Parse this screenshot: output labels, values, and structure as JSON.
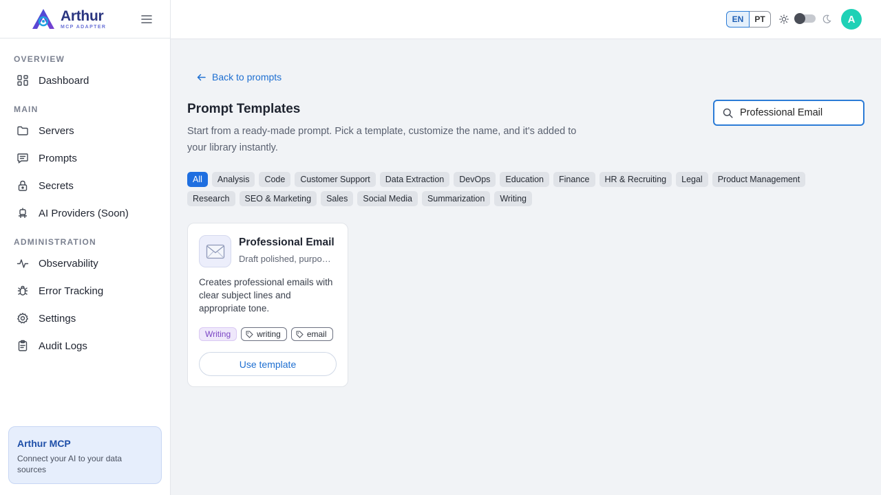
{
  "brand": {
    "name": "Arthur",
    "subtitle": "MCP ADAPTER"
  },
  "sidebar": {
    "sections": [
      {
        "label": "OVERVIEW"
      },
      {
        "label": "MAIN"
      },
      {
        "label": "ADMINISTRATION"
      }
    ],
    "items": [
      {
        "label": "Dashboard",
        "icon": "dashboard-icon"
      },
      {
        "label": "Servers",
        "icon": "folder-icon"
      },
      {
        "label": "Prompts",
        "icon": "message-icon"
      },
      {
        "label": "Secrets",
        "icon": "lock-icon"
      },
      {
        "label": "AI Providers (Soon)",
        "icon": "robot-icon"
      },
      {
        "label": "Observability",
        "icon": "activity-icon"
      },
      {
        "label": "Error Tracking",
        "icon": "bug-icon"
      },
      {
        "label": "Settings",
        "icon": "gear-icon"
      },
      {
        "label": "Audit Logs",
        "icon": "clipboard-icon"
      }
    ],
    "promo": {
      "title": "Arthur MCP",
      "description": "Connect your AI to your data sources"
    }
  },
  "topbar": {
    "languages": [
      "EN",
      "PT"
    ],
    "selected_language": "EN",
    "avatar_initial": "A"
  },
  "main": {
    "back_label": "Back to prompts",
    "title": "Prompt Templates",
    "description": "Start from a ready-made prompt. Pick a template, customize the name, and it's added to your library instantly.",
    "search": {
      "value": "Professional Email"
    },
    "categories": [
      "All",
      "Analysis",
      "Code",
      "Customer Support",
      "Data Extraction",
      "DevOps",
      "Education",
      "Finance",
      "HR & Recruiting",
      "Legal",
      "Product Management",
      "Research",
      "SEO & Marketing",
      "Sales",
      "Social Media",
      "Summarization",
      "Writing"
    ],
    "active_category": "All",
    "templates": [
      {
        "title": "Professional Email",
        "subtitle": "Draft polished, purposeful emails",
        "description": "Creates professional emails with clear subject lines and appropriate tone.",
        "category": "Writing",
        "tags": [
          "writing",
          "email"
        ],
        "icon": "envelope-icon",
        "action_label": "Use template"
      }
    ]
  },
  "colors": {
    "accent": "#1f6fe0",
    "avatar": "#1fd1b6",
    "brand": "#2a3580"
  }
}
